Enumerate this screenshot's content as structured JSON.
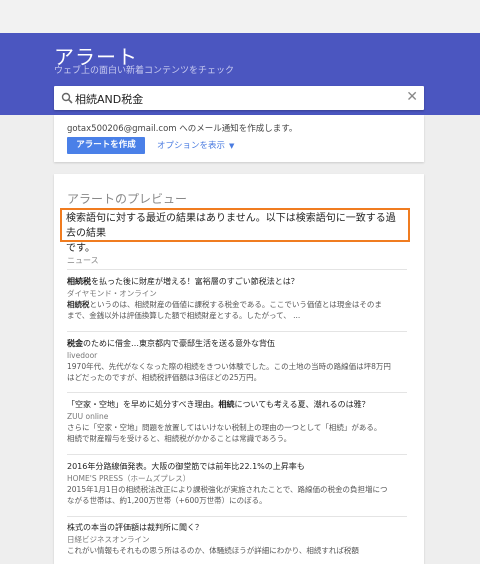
{
  "header": {
    "title": "アラート",
    "subtitle": "ウェブ上の面白い新着コンテンツをチェック",
    "bg_color": "#4b56c0"
  },
  "search": {
    "query": "相続AND税金",
    "icon": "search-icon",
    "clear_icon": "close-icon"
  },
  "create_card": {
    "notice": "gotax500206@gmail.com へのメール通知を作成します。",
    "create_label": "アラートを作成",
    "options_label": "オプションを表示",
    "accent": "#4a80e8"
  },
  "preview": {
    "title": "アラートのプレビュー",
    "no_result_line1": "検索語句に対する最近の結果はありません。以下は検索語句に一致する過去の結果",
    "no_result_line2": "です。",
    "highlight_color": "#f07c20",
    "section_label": "ニュース",
    "items": [
      {
        "title_pre": "",
        "title_bold": "相続税",
        "title_post": "を払った後に財産が増える！富裕層のすごい節税法とは？",
        "source": "ダイヤモンド・オンライン",
        "desc1_bold": "相続税",
        "desc1": "というのは、相続財産の価値に課税する税金である。ここでいう価値とは現金はそのま",
        "desc2": "まで、金銭以外は評価換算した額で相続財産とする。したがって、 ..."
      },
      {
        "title_pre": "",
        "title_bold": "税金",
        "title_post": "のために借金…東京都内で豪邸生活を送る意外な背伍",
        "source": "livedoor",
        "desc1_bold": "",
        "desc1": "1970年代、先代がなくなった際の相続をきつい体験でした。この土地の当時の路線価は坪8万円",
        "desc2": "はどだったのですが、相続税評価額は3倍ほどの25万円。"
      },
      {
        "title_pre": "「空家・空地」を早めに処分すべき理由。",
        "title_bold": "相続",
        "title_post": "についても考える夏、潮れるのは雅？",
        "source": "ZUU online",
        "desc1_bold": "",
        "desc1": "さらに「空家・空地」問題を放置してはいけない税制上の理由の一つとして「相続」がある。",
        "desc2": "相続で財産贈与を受けると、相続税がかかることは常識であろう。"
      },
      {
        "title_pre": "2016年分路線価発表。大阪の御堂筋では前年比22.1%の上昇率も",
        "title_bold": "",
        "title_post": "",
        "source": "HOME'S PRESS（ホームズプレス）",
        "desc1_bold": "",
        "desc1": "2015年1月1日の相続税法改正により課税強化が実施されたことで、路線価の税金の負担増につ",
        "desc2": "ながる世帯は、約1,200万世帯（+600万世帯）にのぼる。"
      },
      {
        "title_pre": "株式の本当の評価額は裁判所に聞く？",
        "title_bold": "",
        "title_post": "",
        "source": "日経ビジネスオンライン",
        "desc1_bold": "",
        "desc1": "これがい情報もそれもの思う所はるのか、体騒続ほうが詳細にわかり、相続すれば税額",
        "desc2": ""
      }
    ]
  }
}
